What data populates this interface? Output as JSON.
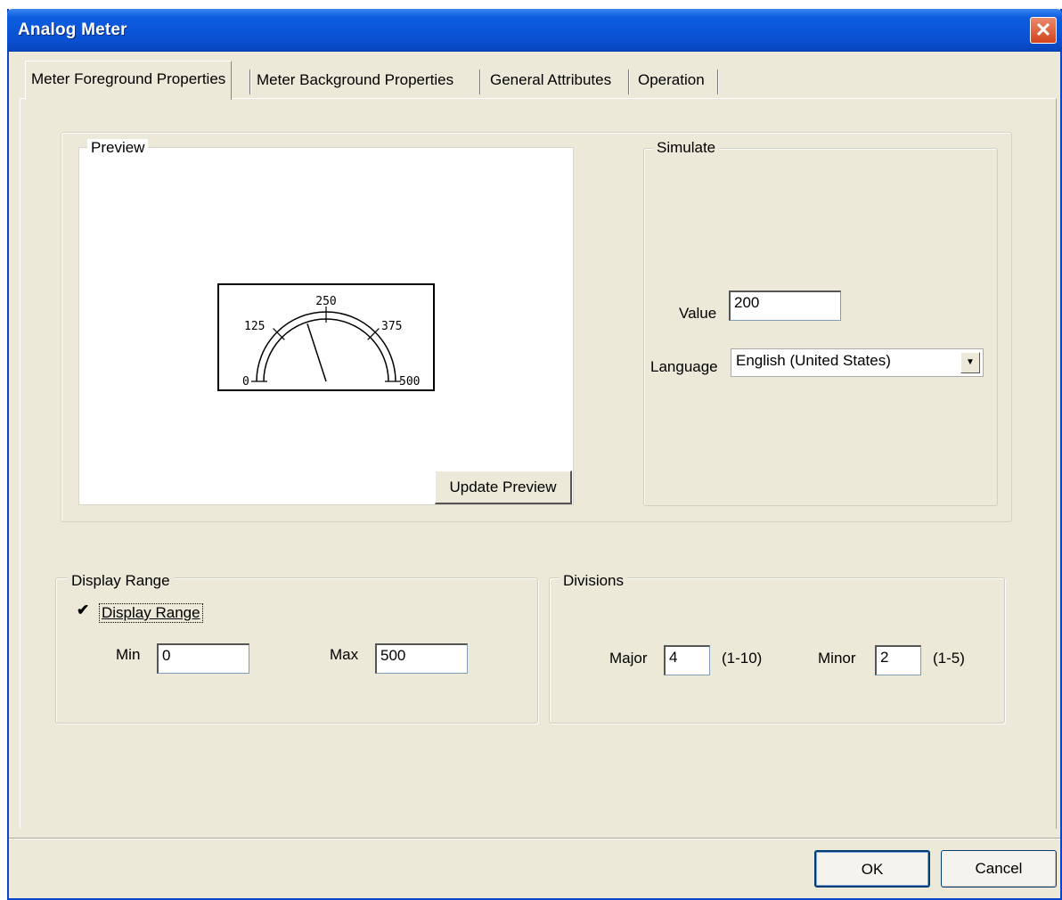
{
  "window": {
    "title": "Analog Meter",
    "close_icon": "close-icon"
  },
  "tabs": [
    {
      "label": "Meter Foreground Properties",
      "active": true
    },
    {
      "label": "Meter Background Properties",
      "active": false
    },
    {
      "label": "General Attributes",
      "active": false
    },
    {
      "label": "Operation",
      "active": false
    }
  ],
  "preview": {
    "label": "Preview",
    "update_button": "Update Preview",
    "meter": {
      "min": 0,
      "max": 500,
      "value": 200,
      "major_divisions": 4,
      "labels": [
        "0",
        "125",
        "250",
        "375",
        "500"
      ]
    }
  },
  "simulate": {
    "label": "Simulate",
    "value_label": "Value",
    "value": "200",
    "language_label": "Language",
    "language_value": "English (United States)"
  },
  "display_range": {
    "label": "Display Range",
    "checkbox_label": "Display Range",
    "checked": true,
    "min_label": "Min",
    "min_value": "0",
    "max_label": "Max",
    "max_value": "500"
  },
  "divisions": {
    "label": "Divisions",
    "major_label": "Major",
    "major_value": "4",
    "major_range": "(1-10)",
    "minor_label": "Minor",
    "minor_value": "2",
    "minor_range": "(1-5)"
  },
  "buttons": {
    "ok": "OK",
    "cancel": "Cancel"
  }
}
